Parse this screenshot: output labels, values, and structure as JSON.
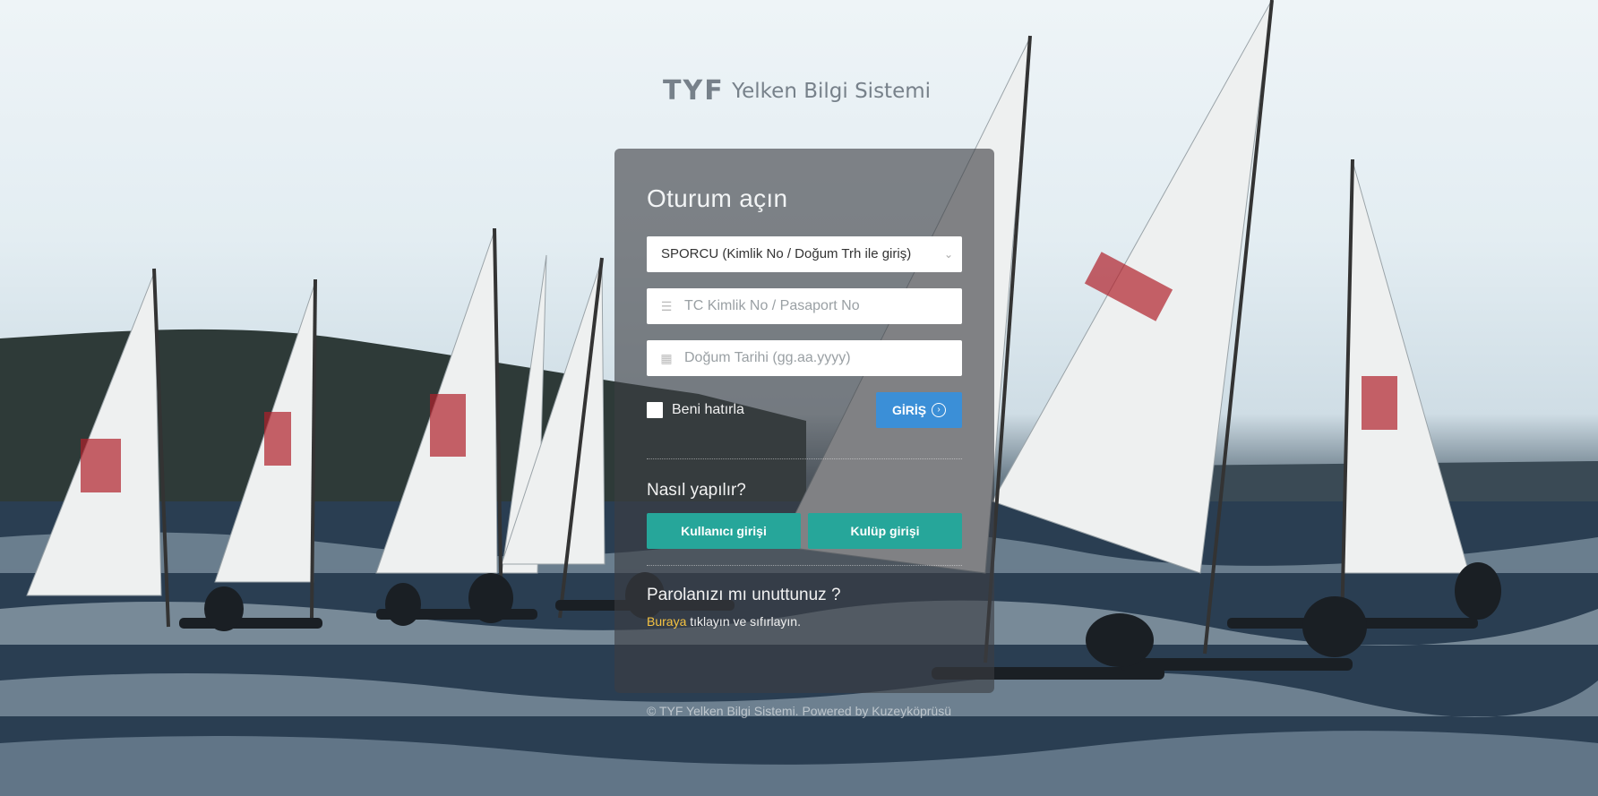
{
  "brand": {
    "logo_text": "TYF",
    "name": "Yelken Bilgi Sistemi"
  },
  "login": {
    "title": "Oturum açın",
    "user_type_select": "SPORCU (Kimlik No / Doğum Trh ile giriş)",
    "id_placeholder": "TC Kimlik No / Pasaport No",
    "birthdate_placeholder": "Doğum Tarihi (gg.aa.yyyy)",
    "remember_label": "Beni hatırla",
    "submit_label": "GİRİŞ"
  },
  "help": {
    "title": "Nasıl yapılır?",
    "user_login_button": "Kullanıcı girişi",
    "club_login_button": "Kulüp girişi"
  },
  "forgot": {
    "title": "Parolanızı mı unuttunuz ?",
    "link_text": "Buraya",
    "rest_text": " tıklayın ve sıfırlayın."
  },
  "footer": {
    "text": "© TYF Yelken Bilgi Sistemi. Powered by Kuzeyköprüsü"
  },
  "colors": {
    "accent_blue": "#3b8fd7",
    "accent_teal": "#26a69a",
    "link_yellow": "#f6c342",
    "panel": "rgba(60,62,66,0.62)"
  }
}
